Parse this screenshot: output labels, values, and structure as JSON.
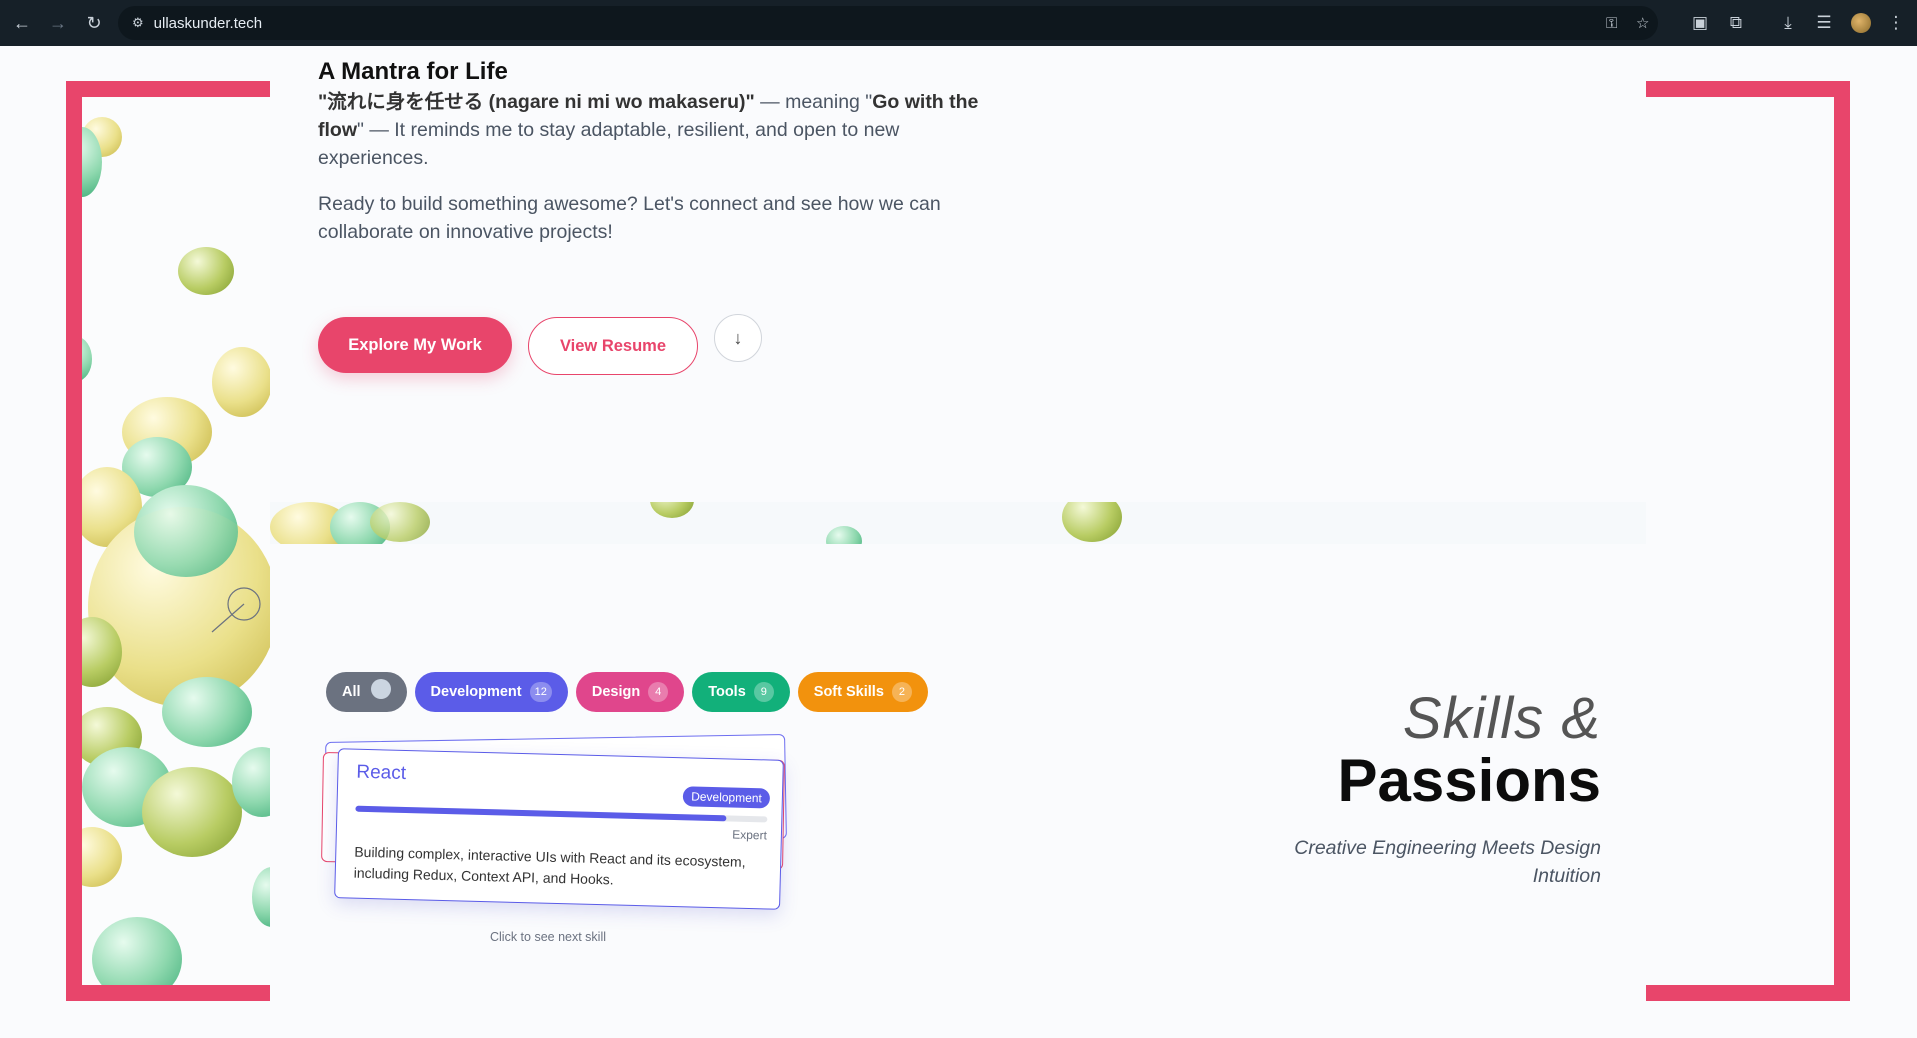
{
  "browser": {
    "url": "ullaskunder.tech"
  },
  "about": {
    "mantra_title": "A Mantra for Life",
    "mantra_quote": "\"流れに身を任せる (nagare ni mi wo makaseru)\"",
    "mantra_meaning_prefix": " — meaning \"",
    "mantra_meaning": "Go with the flow",
    "mantra_rest": "\" — It reminds me to stay adaptable, resilient, and open to new experiences.",
    "cta_text": "Ready to build something awesome? Let's connect and see how we can collaborate on innovative projects!",
    "explore_label": "Explore My Work",
    "resume_label": "View Resume"
  },
  "skills": {
    "filters": [
      {
        "label": "All",
        "count": ""
      },
      {
        "label": "Development",
        "count": "12"
      },
      {
        "label": "Design",
        "count": "4"
      },
      {
        "label": "Tools",
        "count": "9"
      },
      {
        "label": "Soft Skills",
        "count": "2"
      }
    ],
    "card": {
      "name": "React",
      "category": "Development",
      "level": "Expert",
      "level_fraction": 0.9,
      "description": "Building complex, interactive UIs with React and its ecosystem, including Redux, Context API, and Hooks."
    },
    "hint": "Click to see next skill",
    "title_line1": "Skills &",
    "title_line2": "Passions",
    "subtitle": "Creative Engineering Meets Design Intuition"
  },
  "colors": {
    "accent": "#e8456b",
    "development": "#5b5ce8",
    "design": "#e0468c",
    "tools": "#12b07a",
    "soft_skills": "#f2920d"
  },
  "icons": {
    "back": "arrow-left-icon",
    "forward": "arrow-right-icon",
    "reload": "reload-icon",
    "site_info": "site-info-icon",
    "password": "key-icon",
    "bookmark": "star-icon",
    "extensions": "puzzle-icon",
    "downloads": "download-icon",
    "menu": "kebab-menu-icon",
    "scroll_down": "arrow-down-icon"
  }
}
